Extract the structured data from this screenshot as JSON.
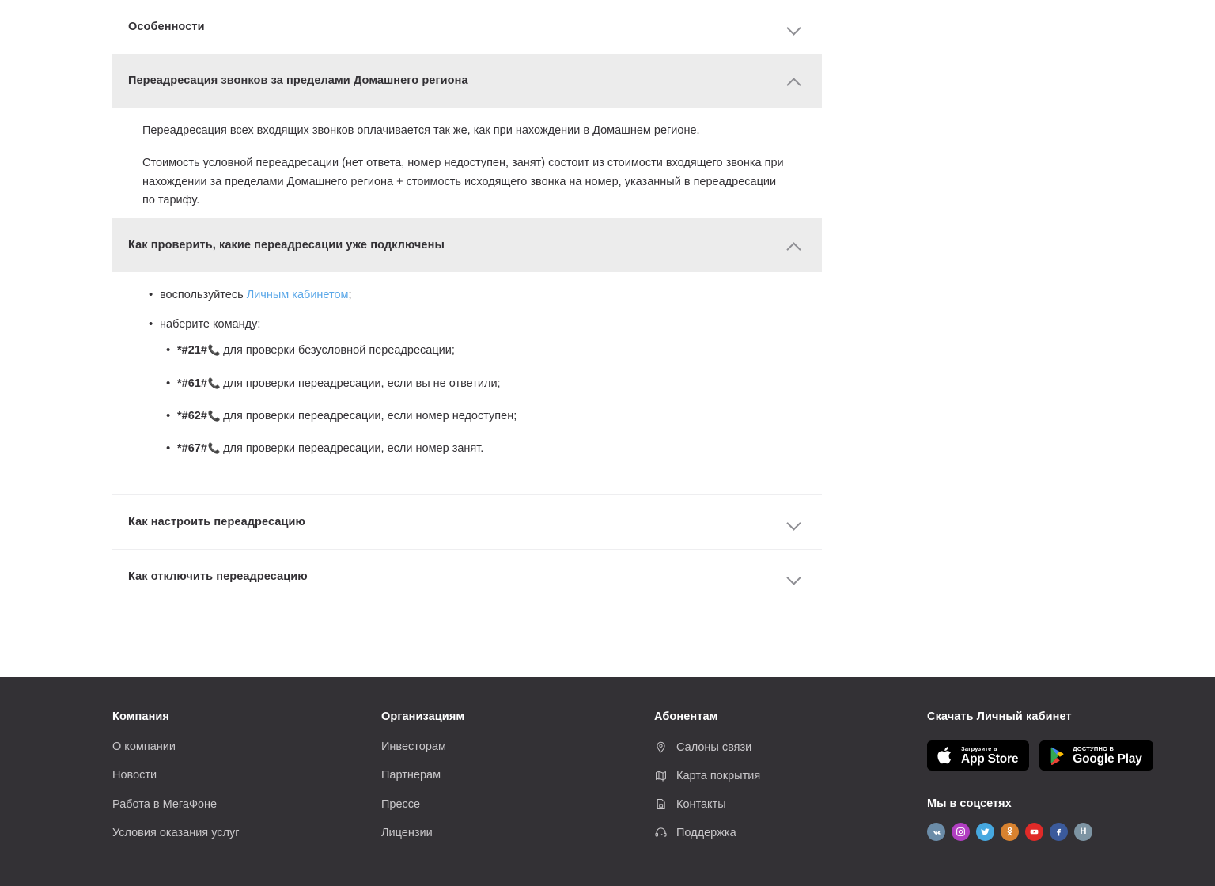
{
  "accordion": {
    "items": [
      {
        "title": "Особенности",
        "state": "collapsed",
        "icon": "chevron-down-icon"
      },
      {
        "title": "Переадресация звонков за пределами Домашнего региона",
        "state": "expanded",
        "icon": "chevron-up-icon"
      },
      {
        "title": "Как проверить, какие переадресации уже подключены",
        "state": "expanded",
        "icon": "chevron-up-icon"
      },
      {
        "title": "Как настроить переадресацию",
        "state": "collapsed",
        "icon": "chevron-down-icon"
      },
      {
        "title": "Как отключить переадресацию",
        "state": "collapsed",
        "icon": "chevron-down-icon"
      }
    ],
    "forwarding_body": {
      "p1": "Переадресация всех входящих звонков оплачивается так же, как при нахождении в Домашнем регионе.",
      "p2": "Стоимость условной переадресации (нет ответа, номер недоступен, занят) состоит из стоимости входящего звонка при нахождении за пределами Домашнего региона + стоимость исходящего звонка на номер, указанный в переадресации по тарифу."
    },
    "check_body": {
      "bullet1_prefix": "воспользуйтесь ",
      "bullet1_link": "Личным кабинетом",
      "bullet1_suffix": ";",
      "bullet2": "наберите команду:",
      "phone_icon": "📞",
      "commands": [
        {
          "code": "*#21#",
          "text": "для проверки безусловной переадресации;"
        },
        {
          "code": "*#61#",
          "text": "для проверки переадресации, если вы не ответили;"
        },
        {
          "code": "*#62#",
          "text": "для проверки переадресации, если номер недоступен;"
        },
        {
          "code": "*#67#",
          "text": "для проверки переадресации, если номер занят."
        }
      ]
    }
  },
  "footer": {
    "columns": [
      {
        "heading": "Компания",
        "links": [
          "О компании",
          "Новости",
          "Работа в МегаФоне",
          "Условия оказания услуг"
        ]
      },
      {
        "heading": "Организациям",
        "links": [
          "Инвесторам",
          "Партнерам",
          "Прессе",
          "Лицензии"
        ]
      },
      {
        "heading": "Абонентам",
        "links": [
          {
            "label": "Салоны связи",
            "icon": "map-pin-icon"
          },
          {
            "label": "Карта покрытия",
            "icon": "map-icon"
          },
          {
            "label": "Контакты",
            "icon": "sim-card-icon"
          },
          {
            "label": "Поддержка",
            "icon": "headset-icon"
          }
        ]
      }
    ],
    "download": {
      "heading": "Скачать Личный кабинет",
      "appstore": {
        "small": "Загрузите в",
        "big": "App Store",
        "icon": "apple-icon"
      },
      "googleplay": {
        "small": "ДОСТУПНО В",
        "big": "Google Play",
        "icon": "google-play-icon"
      }
    },
    "socials": {
      "heading": "Мы в соцсетях",
      "items": [
        {
          "name": "vk-icon",
          "label": "VK",
          "color": "#6b8ca8"
        },
        {
          "name": "instagram-icon",
          "label": "",
          "color": "#b13ec1"
        },
        {
          "name": "twitter-icon",
          "label": "",
          "color": "#46a8e0"
        },
        {
          "name": "odnoklassniki-icon",
          "label": "",
          "color": "#d8822f"
        },
        {
          "name": "youtube-icon",
          "label": "",
          "color": "#e02a28"
        },
        {
          "name": "facebook-icon",
          "label": "f",
          "color": "#3b5a9b"
        },
        {
          "name": "habr-icon",
          "label": "H",
          "color": "#7d94a3"
        }
      ]
    }
  },
  "colors": {
    "accent_link": "#5aa7e8",
    "header_open_bg": "#ececec",
    "footer_bg": "#333135",
    "phone_green": "#3aaa55"
  }
}
